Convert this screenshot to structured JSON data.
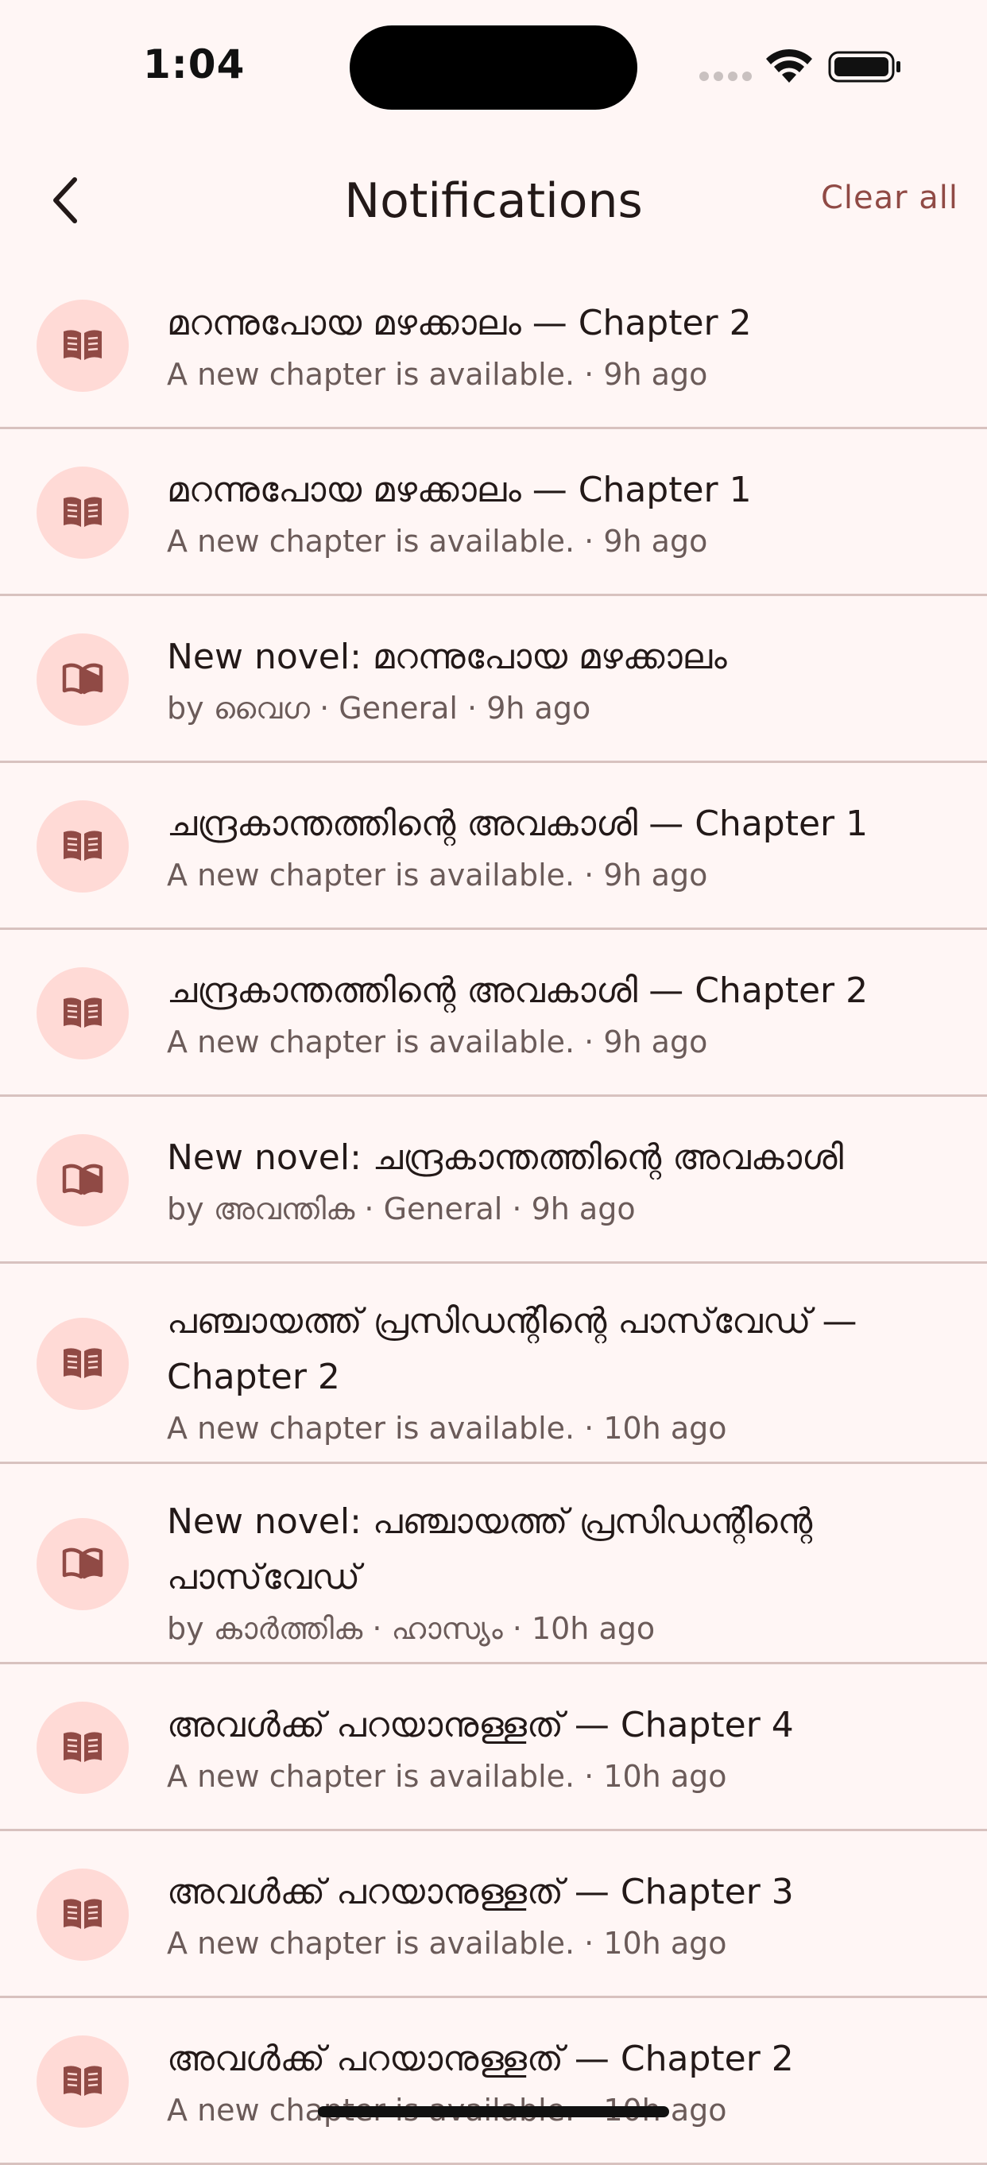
{
  "status_bar": {
    "time": "1:04"
  },
  "header": {
    "title": "Notifications",
    "clear_label": "Clear all"
  },
  "colors": {
    "background": "#fff6f5",
    "accent": "#904a45",
    "icon_bg": "#ffdad6",
    "icon_fg": "#904a45",
    "divider": "#d8c2bf"
  },
  "notifications": [
    {
      "icon": "book-icon",
      "title": "മറന്നുപോയ മഴക്കാലം — Chapter 2",
      "subtitle": "A new chapter is available. · 9h ago"
    },
    {
      "icon": "book-icon",
      "title": "മറന്നുപോയ മഴക്കാലം — Chapter 1",
      "subtitle": "A new chapter is available. · 9h ago"
    },
    {
      "icon": "open-book-icon",
      "title": "New novel: മറന്നുപോയ മഴക്കാലം",
      "subtitle": "by വൈഗ · General · 9h ago"
    },
    {
      "icon": "book-icon",
      "title": "ചന്ദ്രകാന്തത്തിന്റെ അവകാശി — Chapter 1",
      "subtitle": "A new chapter is available. · 9h ago"
    },
    {
      "icon": "book-icon",
      "title": "ചന്ദ്രകാന്തത്തിന്റെ അവകാശി — Chapter 2",
      "subtitle": "A new chapter is available. · 9h ago"
    },
    {
      "icon": "open-book-icon",
      "title": "New novel: ചന്ദ്രകാന്തത്തിന്റെ അവകാശി",
      "subtitle": "by അവന്തിക · General · 9h ago"
    },
    {
      "icon": "book-icon",
      "title": "പഞ്ചായത്ത് പ്രസിഡന്റിന്റെ പാസ്‌വേഡ് — Chapter 2",
      "subtitle": "A new chapter is available. · 10h ago"
    },
    {
      "icon": "open-book-icon",
      "title": "New novel: പഞ്ചായത്ത് പ്രസിഡന്റിന്റെ പാസ്‌വേഡ്",
      "subtitle": "by കാർത്തിക · ഹാസ്യം · 10h ago"
    },
    {
      "icon": "book-icon",
      "title": "അവൾക്ക് പറയാനുള്ളത് — Chapter 4",
      "subtitle": "A new chapter is available. · 10h ago"
    },
    {
      "icon": "book-icon",
      "title": "അവൾക്ക് പറയാനുള്ളത് — Chapter 3",
      "subtitle": "A new chapter is available. · 10h ago"
    },
    {
      "icon": "book-icon",
      "title": "അവൾക്ക് പറയാനുള്ളത് — Chapter 2",
      "subtitle": "A new chapter is available. · 10h ago"
    }
  ]
}
